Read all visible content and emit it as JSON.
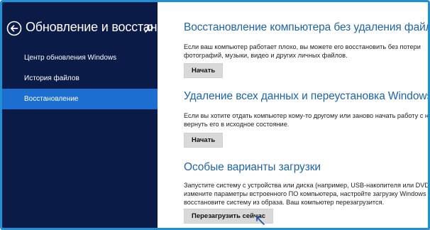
{
  "sidebar": {
    "title": "Обновление и восстан…",
    "items": [
      {
        "label": "Центр обновления Windows"
      },
      {
        "label": "История файлов"
      },
      {
        "label": "Восстановление"
      }
    ]
  },
  "sections": [
    {
      "title": "Восстановление компьютера без удаления файлов",
      "desc_lines": [
        "Если ваш компьютер работает плохо, вы можете его восстановить без потери",
        "фотографий, музыки, видео и других личных файлов."
      ],
      "button": "Начать"
    },
    {
      "title": "Удаление всех данных и переустановка Windows",
      "desc_lines": [
        "Если вы хотите отдать компьютер кому-то другому или заново начать работу с ним, можно",
        "вернуть его в исходное состояние."
      ],
      "button": "Начать"
    },
    {
      "title": "Особые варианты загрузки",
      "desc_lines": [
        "Запустите систему с устройства или диска (например, USB-накопителя или DVD-диска),",
        "измените параметры встроенного ПО компьютера, настройте загрузку Windows или",
        "восстановите систему из образа. Ваш компьютер перезагрузится."
      ],
      "button": "Перезагрузить сейчас"
    }
  ],
  "colors": {
    "sidebar_bg": "#0b1b48",
    "active_item": "#1c6fd0",
    "title_blue": "#1f64a8",
    "frame_border": "#1f8fd6"
  }
}
